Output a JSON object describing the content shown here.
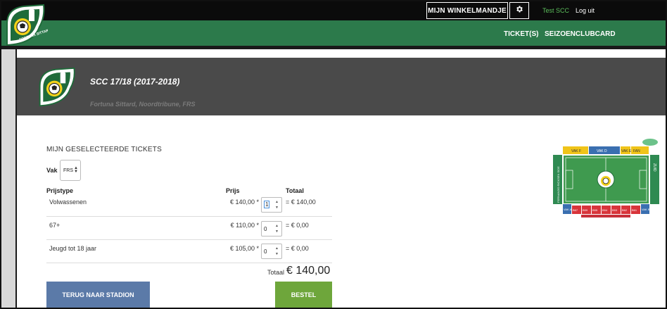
{
  "header": {
    "cart_label": "MIJN WINKELMANDJE",
    "user_name": "Test SCC",
    "logout_label": "Log uit"
  },
  "nav": {
    "tickets_label": "TICKET(S)",
    "season_label": "SEIZOENCLUBCARD"
  },
  "event": {
    "title": "SCC 17/18 (2017-2018)",
    "subtitle": "Fortuna Sittard, Noordtribune, FRS"
  },
  "tickets": {
    "section_title": "MIJN GESELECTEERDE TICKETS",
    "vak_label": "Vak",
    "vak_value": "FRS",
    "columns": {
      "type": "Prijstype",
      "price": "Prijs",
      "total": "Totaal"
    },
    "rows": [
      {
        "label": "Volwassenen",
        "price": "€ 140,00 *",
        "qty": "1",
        "total": "= € 140,00"
      },
      {
        "label": "67+",
        "price": "€ 110,00 *",
        "qty": "0",
        "total": "= € 0,00"
      },
      {
        "label": "Jeugd tot 18 jaar",
        "price": "€ 105,00 *",
        "qty": "0",
        "total": "= € 0,00"
      }
    ],
    "total_label": "Totaal",
    "total_value": "€ 140,00"
  },
  "buttons": {
    "back_label": "TERUG NAAR STADION",
    "order_label": "BESTEL"
  },
  "stadium_map": {
    "top_sections": [
      "VAK F",
      "VAK D",
      "VAK E",
      "FAN"
    ],
    "bottom_sections": [
      "B67",
      "B59",
      "B55",
      "B54",
      "B53",
      "B62",
      "B61"
    ],
    "left_stand": "FERNANDO RICKSEN SIDE",
    "right_stand": "ZUID",
    "vak_a": "VAK A",
    "vak_b": "VAK B"
  },
  "colors": {
    "topbar": "#0b0b0b",
    "brand_green": "#2c7a4b",
    "event_header": "#4a4a4a",
    "back_button": "#5b7aa8",
    "order_button": "#6ea63b",
    "user_name": "#5cbf5c"
  },
  "icons": {
    "settings": "gear-icon",
    "logo": "fortuna-sittard-logo"
  }
}
